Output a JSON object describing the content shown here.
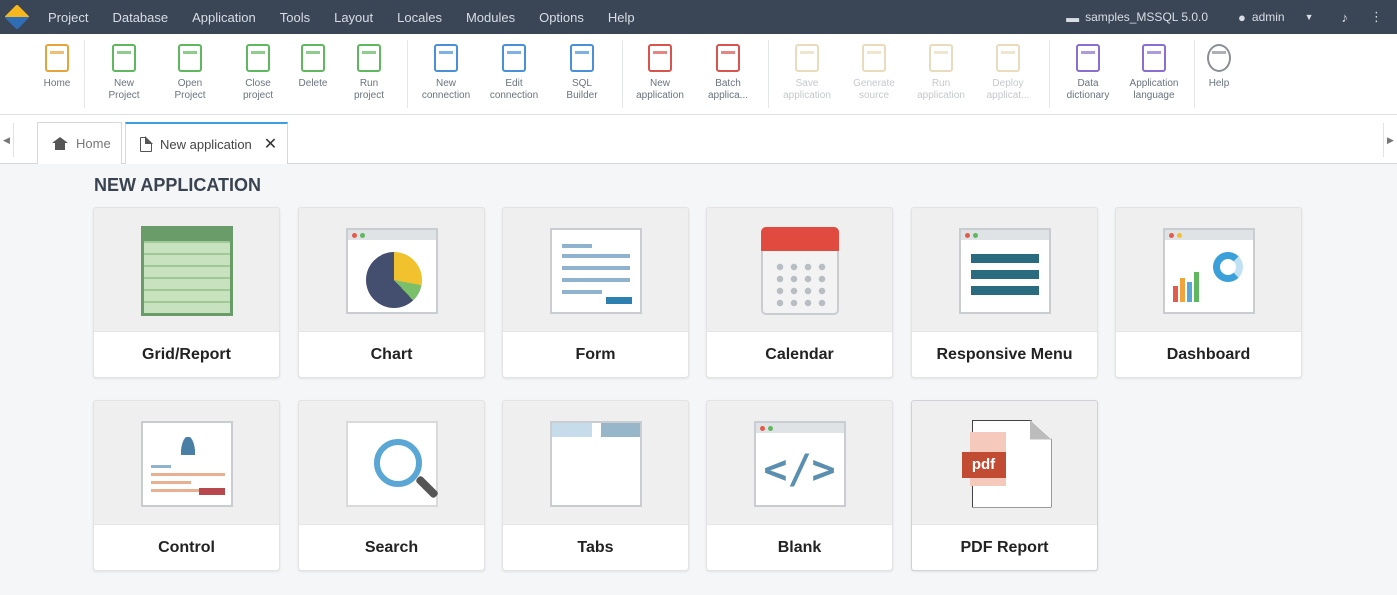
{
  "menubar": {
    "items": [
      "Project",
      "Database",
      "Application",
      "Tools",
      "Layout",
      "Locales",
      "Modules",
      "Options",
      "Help"
    ],
    "project_name": "samples_MSSQL 5.0.0",
    "user": "admin"
  },
  "toolbar": {
    "buttons": [
      {
        "label": "Home",
        "color": "#e8a33a"
      },
      {
        "label": "New\nProject",
        "color": "#5fb85f"
      },
      {
        "label": "Open\nProject",
        "color": "#5fb85f"
      },
      {
        "label": "Close\nproject",
        "color": "#5fb85f"
      },
      {
        "label": "Delete",
        "color": "#5fb85f"
      },
      {
        "label": "Run\nproject",
        "color": "#5fb85f"
      },
      {
        "label": "New\nconnection",
        "color": "#4a90d9"
      },
      {
        "label": "Edit\nconnection",
        "color": "#4a90d9"
      },
      {
        "label": "SQL\nBuilder",
        "color": "#4a90d9"
      },
      {
        "label": "New\napplication",
        "color": "#d9534f"
      },
      {
        "label": "Batch\napplica...",
        "color": "#d9534f"
      },
      {
        "label": "Save\napplication",
        "color": "#c9a85a"
      },
      {
        "label": "Generate\nsource",
        "color": "#c9a85a"
      },
      {
        "label": "Run\napplication",
        "color": "#c9a85a"
      },
      {
        "label": "Deploy\napplicat...",
        "color": "#c9a85a"
      },
      {
        "label": "Data\ndictionary",
        "color": "#8a6fd1"
      },
      {
        "label": "Application\nlanguage",
        "color": "#8a6fd1"
      },
      {
        "label": "Help",
        "color": "#8a8f96"
      }
    ]
  },
  "tabs": {
    "home": "Home",
    "active": "New application"
  },
  "page": {
    "title": "NEW APPLICATION",
    "cards": [
      "Grid/Report",
      "Chart",
      "Form",
      "Calendar",
      "Responsive Menu",
      "Dashboard",
      "Control",
      "Search",
      "Tabs",
      "Blank",
      "PDF Report"
    ],
    "pdf_tag": "pdf"
  }
}
